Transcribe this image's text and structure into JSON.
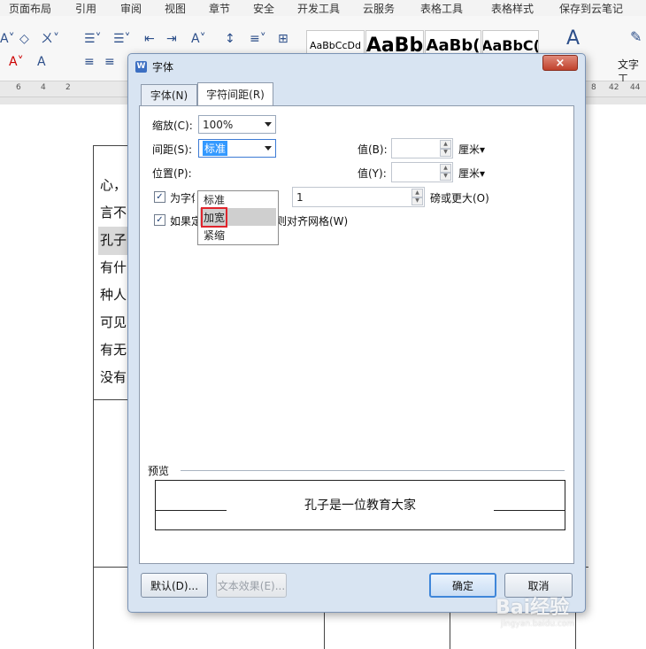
{
  "menubar": {
    "items": [
      "页面布局",
      "引用",
      "审阅",
      "视图",
      "章节",
      "安全",
      "开发工具",
      "云服务",
      "表格工具",
      "表格样式",
      "保存到云笔记"
    ]
  },
  "toolbar": {
    "styles": [
      "AaBbCcDd",
      "AaBb",
      "AaBb(",
      "AaBbC("
    ],
    "text_tools_label": "文字工"
  },
  "ruler": {
    "labels": [
      "6",
      "4",
      "2",
      "8",
      "42",
      "44"
    ]
  },
  "document": {
    "lines": [
      "心，",
      "言不",
      "孔子",
      "有什",
      "种人",
      "可见",
      "有无",
      "没有"
    ]
  },
  "dialog": {
    "title": "字体",
    "close_glyph": "×",
    "tabs": [
      "字体(N)",
      "字符间距(R)"
    ],
    "scale_label": "缩放(C):",
    "scale_value": "100%",
    "spacing_label": "间距(S):",
    "spacing_value": "标准",
    "position_label": "位置(P):",
    "value_b_label": "值(B):",
    "value_y_label": "值(Y):",
    "unit_cm": "厘米",
    "kerning_label": "为字体调整字间距",
    "kerning_value": "1",
    "kerning_suffix": "磅或更大(O)",
    "grid_label": "如果定义了文档网格，则对齐网格(W)",
    "dropdown_options": [
      "标准",
      "加宽",
      "紧缩"
    ],
    "preview_label": "预览",
    "preview_text": "孔子是一位教育大家",
    "default_button": "默认(D)...",
    "text_effect_button": "文本效果(E)...",
    "ok_button": "确定",
    "cancel_button": "取消"
  },
  "watermark": {
    "text": "Bai经验",
    "sub": "jingyan.baidu.com"
  }
}
